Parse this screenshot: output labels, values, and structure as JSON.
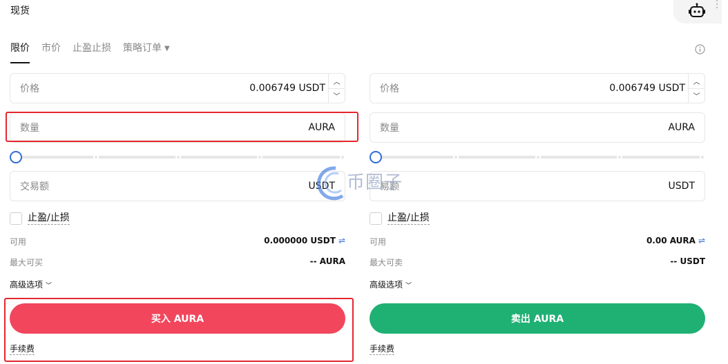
{
  "header": {
    "title": "现货"
  },
  "tabs": [
    {
      "label": "限价",
      "active": true
    },
    {
      "label": "市价",
      "active": false
    },
    {
      "label": "止盈止损",
      "active": false
    },
    {
      "label": "策略订单",
      "active": false
    }
  ],
  "buy": {
    "price_label": "价格",
    "price_value": "0.006749 USDT",
    "qty_label": "数量",
    "qty_unit": "AURA",
    "slider_percent": 0,
    "total_label": "交易额",
    "total_unit": "USDT",
    "tp_sl_label": "止盈/止损",
    "available_label": "可用",
    "available_value": "0.000000 USDT",
    "max_label": "最大可买",
    "max_value": "-- AURA",
    "advanced_label": "高级选项",
    "action_label": "买入 AURA",
    "fee_label": "手续费"
  },
  "sell": {
    "price_label": "价格",
    "price_value": "0.006749 USDT",
    "qty_label": "数量",
    "qty_unit": "AURA",
    "slider_percent": 0,
    "total_label": "易额",
    "total_unit": "USDT",
    "tp_sl_label": "止盈/止损",
    "available_label": "可用",
    "available_value": "0.00 AURA",
    "max_label": "最大可卖",
    "max_value": "-- USDT",
    "advanced_label": "高级选项",
    "action_label": "卖出 AURA",
    "fee_label": "手续费"
  },
  "watermark": {
    "text": "币圈子"
  },
  "colors": {
    "buy": "#f2465c",
    "sell": "#1fb074",
    "accent": "#2f6bd6",
    "highlight": "#e3262f"
  },
  "icons": {
    "header": "robot-icon",
    "info": "info-icon",
    "swap": "swap-icon",
    "dropdown": "chevron-down-icon",
    "spinner_up": "chevron-up-icon",
    "spinner_down": "chevron-down-icon"
  }
}
